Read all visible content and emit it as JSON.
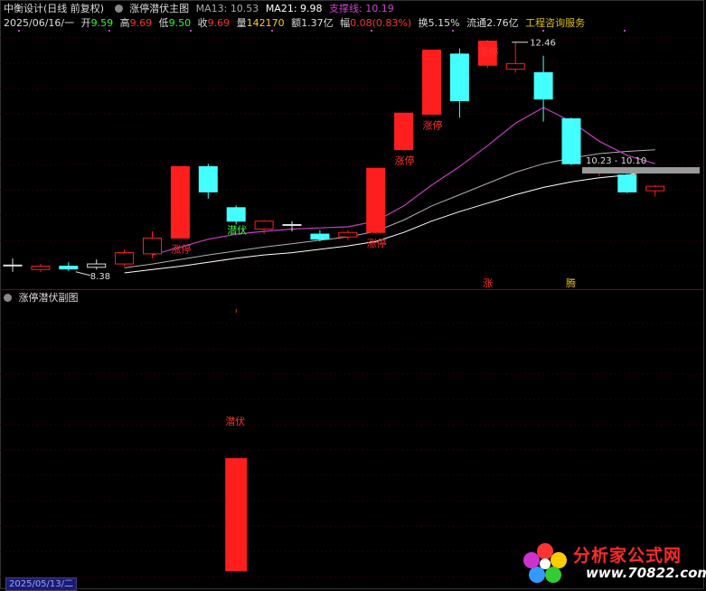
{
  "header": {
    "app_title": "中衡设计(日线 前复权)",
    "indicator_name": "涨停潜伏主图",
    "ma13_label": "MA13:",
    "ma13_value": "10.53",
    "ma21_label": "MA21:",
    "ma21_value": "9.98",
    "support_label": "支撑线:",
    "support_value": "10.19"
  },
  "ohlc": {
    "date": "2025/06/16/一",
    "open_label": "开",
    "open_value": "9.59",
    "high_label": "高",
    "high_value": "9.69",
    "low_label": "低",
    "low_value": "9.50",
    "close_label": "收",
    "close_value": "9.69",
    "volume_label": "量",
    "volume_value": "142170",
    "amount_label": "额",
    "amount_value": "1.37亿",
    "change_label": "幅",
    "change_value": "0.08(0.83%)",
    "turnover_label": "换",
    "turnover_value": "5.15%",
    "float_label": "流通",
    "float_value": "2.76亿",
    "service_text": "工程咨询服务"
  },
  "annotations": {
    "limit_up": "涨停",
    "ambush": "潜伏",
    "price_high": "12.46",
    "price_low": "8.38",
    "range_box": "10.23 - 10.10",
    "bottom_marker_a": "涨",
    "bottom_marker_b": "腾"
  },
  "sub_panel": {
    "title": "涨停潜伏副图",
    "ambush_label": "潜伏"
  },
  "footer": {
    "date_badge": "2025/05/13/二"
  },
  "logo": {
    "brand": "分析家公式网",
    "url": "www.70822.com"
  },
  "colors": {
    "up": "#ff1e1e",
    "down": "#4ff",
    "ma13": "#c040c0",
    "ma21": "#b0b0b0",
    "support": "#ffffff",
    "label_red": "#ff3030",
    "label_green": "#40ff40"
  },
  "chart_data": {
    "type": "candlestick",
    "date": "2025/06/16",
    "candles": [
      {
        "o": 8.5,
        "h": 8.62,
        "l": 8.38,
        "c": 8.5,
        "color": "flat"
      },
      {
        "o": 8.42,
        "h": 8.52,
        "l": 8.38,
        "c": 8.48,
        "color": "up"
      },
      {
        "o": 8.48,
        "h": 8.55,
        "l": 8.4,
        "c": 8.43,
        "color": "down"
      },
      {
        "o": 8.46,
        "h": 8.6,
        "l": 8.42,
        "c": 8.52,
        "color": "flat"
      },
      {
        "o": 8.52,
        "h": 8.78,
        "l": 8.48,
        "c": 8.72,
        "color": "up"
      },
      {
        "o": 8.7,
        "h": 9.1,
        "l": 8.62,
        "c": 8.98,
        "color": "up"
      },
      {
        "o": 8.98,
        "h": 10.25,
        "l": 8.98,
        "c": 10.25,
        "color": "up",
        "tag": "limit_up"
      },
      {
        "o": 10.25,
        "h": 10.3,
        "l": 9.68,
        "c": 9.8,
        "color": "down"
      },
      {
        "o": 9.52,
        "h": 9.56,
        "l": 9.22,
        "c": 9.28,
        "color": "down",
        "tag": "ambush"
      },
      {
        "o": 9.14,
        "h": 9.3,
        "l": 9.05,
        "c": 9.28,
        "color": "up"
      },
      {
        "o": 9.22,
        "h": 9.28,
        "l": 9.1,
        "c": 9.22,
        "color": "flat"
      },
      {
        "o": 9.05,
        "h": 9.12,
        "l": 8.92,
        "c": 8.96,
        "color": "down"
      },
      {
        "o": 9.0,
        "h": 9.12,
        "l": 8.95,
        "c": 9.08,
        "color": "up"
      },
      {
        "o": 9.08,
        "h": 10.22,
        "l": 9.06,
        "c": 10.22,
        "color": "up",
        "tag": "limit_up"
      },
      {
        "o": 10.55,
        "h": 11.2,
        "l": 10.55,
        "c": 11.2,
        "color": "up",
        "tag": "limit_up"
      },
      {
        "o": 11.18,
        "h": 12.32,
        "l": 11.18,
        "c": 12.32,
        "color": "up",
        "tag": "limit_up"
      },
      {
        "o": 12.25,
        "h": 12.35,
        "l": 11.12,
        "c": 11.42,
        "color": "down"
      },
      {
        "o": 12.48,
        "h": 12.5,
        "l": 12.0,
        "c": 12.05,
        "color": "up",
        "tag": "limit_up"
      },
      {
        "o": 12.08,
        "h": 12.46,
        "l": 11.92,
        "c": 11.98,
        "color": "up"
      },
      {
        "o": 11.92,
        "h": 12.22,
        "l": 11.05,
        "c": 11.45,
        "color": "down"
      },
      {
        "o": 11.1,
        "h": 11.12,
        "l": 10.28,
        "c": 10.3,
        "color": "down"
      },
      {
        "o": 10.18,
        "h": 10.22,
        "l": 10.08,
        "c": 10.18,
        "color": "up"
      },
      {
        "o": 10.1,
        "h": 10.12,
        "l": 9.78,
        "c": 9.8,
        "color": "down"
      },
      {
        "o": 9.82,
        "h": 9.92,
        "l": 9.72,
        "c": 9.9,
        "color": "up"
      }
    ],
    "ma13": [
      8.4,
      8.42,
      8.44,
      8.48,
      8.55,
      8.68,
      8.82,
      8.96,
      9.05,
      9.1,
      9.14,
      9.16,
      9.18,
      9.28,
      9.55,
      9.92,
      10.25,
      10.62,
      11.02,
      11.3,
      11.05,
      10.7,
      10.45,
      10.3
    ],
    "ma21": [
      8.3,
      8.32,
      8.36,
      8.4,
      8.45,
      8.52,
      8.6,
      8.68,
      8.75,
      8.82,
      8.88,
      8.94,
      9.0,
      9.1,
      9.3,
      9.55,
      9.75,
      9.95,
      10.15,
      10.3,
      10.4,
      10.48,
      10.52,
      10.55
    ],
    "support": [
      8.22,
      8.24,
      8.28,
      8.32,
      8.36,
      8.42,
      8.48,
      8.55,
      8.62,
      8.68,
      8.72,
      8.78,
      8.84,
      8.92,
      9.08,
      9.28,
      9.45,
      9.6,
      9.75,
      9.88,
      9.98,
      10.05,
      10.1,
      10.19
    ],
    "sub_bar": {
      "index": 8,
      "value": 1
    }
  }
}
